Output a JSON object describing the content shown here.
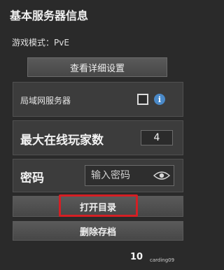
{
  "panel": {
    "title": "基本服务器信息",
    "game_mode": "游戏模式：PvE"
  },
  "buttons": {
    "view_details": "查看详细设置",
    "open_directory": "打开目录",
    "delete_save": "删除存档"
  },
  "lan_server": {
    "label": "局域网服务器",
    "checked": false,
    "info_icon": "i"
  },
  "max_players": {
    "label": "最大在线玩家数",
    "value": "4"
  },
  "password": {
    "label": "密码",
    "placeholder": "输入密码",
    "icon": "eye-icon"
  },
  "footer": {
    "logo": "10",
    "author": "carding09"
  },
  "colors": {
    "highlight": "#d41f24",
    "info": "#4a89c8"
  }
}
